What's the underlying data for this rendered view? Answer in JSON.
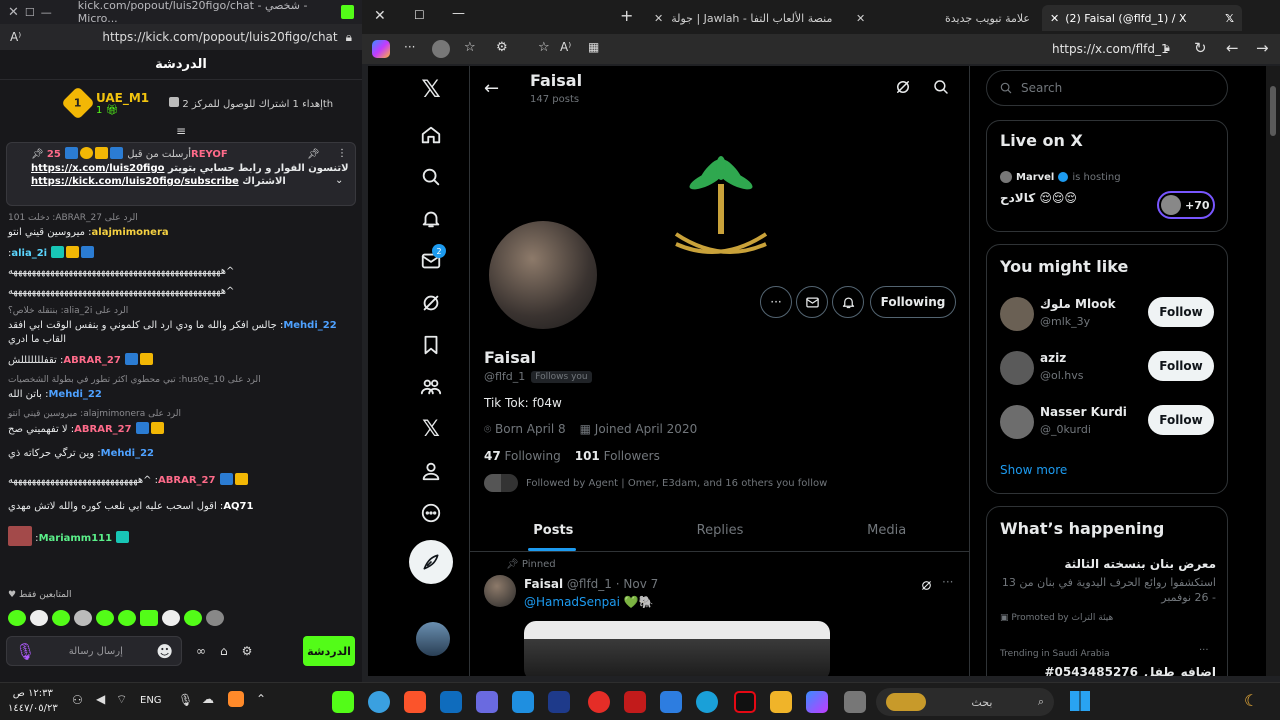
{
  "kick": {
    "window_title": "kick.com/popout/luis20figo/chat - شخصي - Micro...",
    "url": "https://kick.com/popout/luis20figo/chat",
    "header": "الدردشة",
    "gifter": {
      "name": "UAE_M1",
      "count": "1",
      "rank": "1",
      "gift_text": "إهداء 1 اشتراك للوصول للمركز 2",
      "gift_suffix": "th"
    },
    "pinned": {
      "label": "أرسلت من قبل",
      "user": "25REYOF",
      "line1_text": "لاتنسون الفوار و رابط حسابي بتويتر",
      "link1": "https://x.com/luis20figo",
      "line2_text": "الاشتراك",
      "link2": "https://kick.com/luis20figo/subscribe"
    },
    "messages": [
      {
        "reply": "الرد على ABRAR_27: دخلت 101",
        "user": "alajmimonera",
        "color": "#f5d142",
        "text": "ميروسين قيني انتو"
      },
      {
        "reply": "",
        "user": "alia_2i",
        "color": "#5bd6ff",
        "text": ""
      },
      {
        "reply": "",
        "user": "",
        "color": "#ffffff",
        "text": "^ههههههههههههههههههههههههههههههههههههههههههههههه"
      },
      {
        "reply": "",
        "user": "",
        "color": "#ffffff",
        "text": "^ههههههههههههههههههههههههههههههههههههههههههههههه"
      },
      {
        "reply": "الرد على alia_2i: بنتقله خلاص؟",
        "user": "Mehdi_22",
        "color": "#4ea1ff",
        "text": "جالس افكر والله ما ودي ارد الى كلموني و بنفس الوقت ابي افقد القاب ما ادري"
      },
      {
        "reply": "",
        "user": "ABRAR_27",
        "color": "#ff6b8a",
        "text": "تقفلللللللش"
      },
      {
        "reply": "الرد على hus0e_10: تبي محطوي اكثر تطور في بطولة الشخصيات",
        "user": "Mehdi_22",
        "color": "#4ea1ff",
        "text": "باتن الله"
      },
      {
        "reply": "الرد على alajmimonera: ميروسين قيني انتو",
        "user": "ABRAR_27",
        "color": "#ff6b8a",
        "text": "لا تفهميني صح"
      },
      {
        "reply": "",
        "user": "Mehdi_22",
        "color": "#4ea1ff",
        "text": "وين ترگي حركاته ذي"
      },
      {
        "reply": "",
        "user": "ABRAR_27",
        "color": "#ff6b8a",
        "text": "^ههههههههههههههههههههههههههههه"
      },
      {
        "reply": "",
        "user": "AQ71",
        "color": "#ffffff",
        "text": "اقول اسحب عليه ابي نلعب كوره والله لاتش مهدي"
      },
      {
        "reply": "",
        "user": "Mariamm111",
        "color": "#5bf08a",
        "text": ""
      }
    ],
    "followers_only": "المتابعين فقط",
    "input_placeholder": "إرسال رسالة",
    "chat_button": "الدردشة"
  },
  "edge": {
    "tabs": [
      {
        "label": "جولة | Jawlah - منصة الألعاب التفا"
      },
      {
        "label": "علامة تبويب جديدة"
      },
      {
        "label": "(2) Faisal (@flfd_1) / X"
      }
    ],
    "url": "https://x.com/flfd_1"
  },
  "x": {
    "header_name": "Faisal",
    "header_posts": "147 posts",
    "dm_badge": "2",
    "name": "Faisal",
    "handle": "@flfd_1",
    "follows_you": "Follows you",
    "bio": "Tik Tok: f04w",
    "born": "Born April 8",
    "joined": "Joined April 2020",
    "following_count": "47",
    "following_label": "Following",
    "followers_count": "101",
    "followers_label": "Followers",
    "followed_by": "Followed by Agent | Omer, E3dam, and 16 others you follow",
    "following_button": "Following",
    "tabs": [
      "Posts",
      "Replies",
      "Media"
    ],
    "pinned_label": "Pinned",
    "post": {
      "name": "Faisal",
      "handle": "@flfd_1",
      "date": "· Nov 7",
      "text": "@HamadSenpai 💚🐘"
    },
    "search_placeholder": "Search",
    "live": {
      "title": "Live on X",
      "host": "Marvel",
      "hosting": "is hosting",
      "text": "كالادح 😌😌😌",
      "count": "+70"
    },
    "suggest": {
      "title": "You might like",
      "users": [
        {
          "name": "ملوك Mlook",
          "handle": "@mlk_3y",
          "button": "Follow"
        },
        {
          "name": "aziz",
          "handle": "@ol.hvs",
          "button": "Follow"
        },
        {
          "name": "Nasser Kurdi",
          "handle": "@_0kurdi",
          "button": "Follow"
        }
      ],
      "show_more": "Show more"
    },
    "happening": {
      "title": "What’s happening",
      "event_title": "معرض بنان بنسخته الثالثة",
      "event_desc": "استكشفوا روائع الحرف اليدوية في بنان من 13 - 26 نوفمبر",
      "promoted": "Promoted by هيئة التراث",
      "trending_label": "Trending in Saudi Arabia",
      "trend": "#اضافه_طفل_0543485276"
    }
  },
  "taskbar": {
    "time": "١٢:٣٣ ص",
    "date": "١٤٤٧/٠٥/٢٣",
    "lang": "ENG",
    "search_placeholder": "بحث"
  }
}
